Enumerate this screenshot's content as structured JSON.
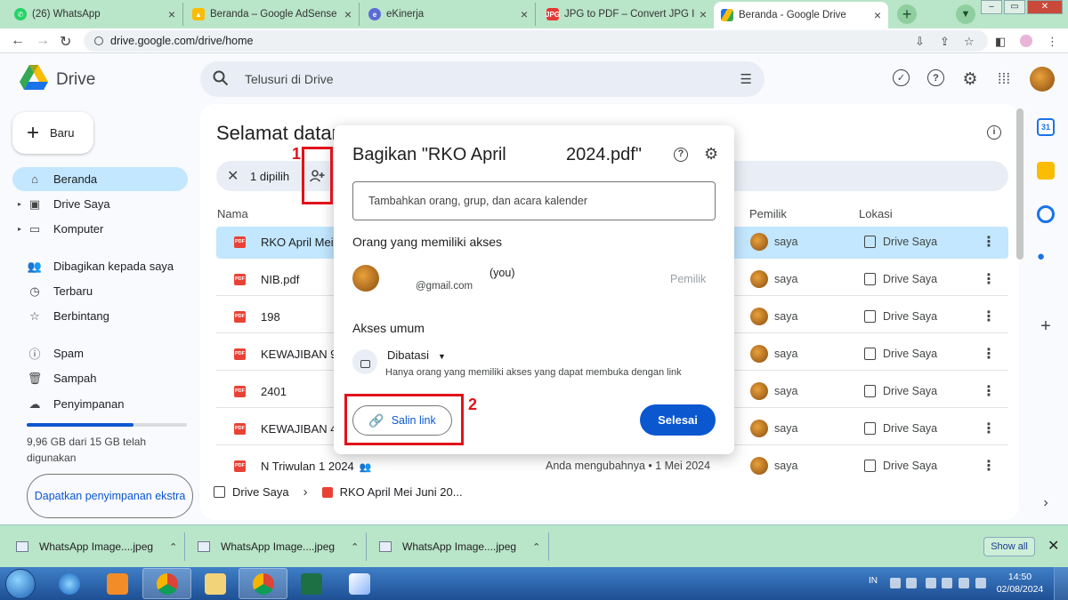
{
  "browser": {
    "tabs": [
      {
        "title": "(26) WhatsApp",
        "icon": "whatsapp-icon",
        "color": "#25d366"
      },
      {
        "title": "Beranda – Google AdSense",
        "icon": "adsense-icon",
        "color": "#fbbc04"
      },
      {
        "title": "eKinerja",
        "icon": "ekinerja-icon",
        "color": "#5b6bd6"
      },
      {
        "title": "JPG to PDF – Convert JPG Images",
        "icon": "jpg-to-pdf-icon",
        "color": "#e53935"
      },
      {
        "title": "Beranda - Google Drive",
        "icon": "google-drive-icon",
        "color": "#1a73e8"
      }
    ],
    "url": "drive.google.com/drive/home"
  },
  "drive": {
    "product_name": "Drive",
    "search_placeholder": "Telusuri di Drive",
    "new_button": "Baru",
    "nav": [
      {
        "label": "Beranda",
        "icon": "home-icon",
        "active": true
      },
      {
        "label": "Drive Saya",
        "icon": "my-drive-icon",
        "expandable": true
      },
      {
        "label": "Komputer",
        "icon": "computer-icon",
        "expandable": true
      },
      {
        "label": "Dibagikan kepada saya",
        "icon": "shared-icon"
      },
      {
        "label": "Terbaru",
        "icon": "clock-icon"
      },
      {
        "label": "Berbintang",
        "icon": "star-icon"
      },
      {
        "label": "Spam",
        "icon": "spam-icon"
      },
      {
        "label": "Sampah",
        "icon": "trash-icon"
      },
      {
        "label": "Penyimpanan",
        "icon": "cloud-icon"
      }
    ],
    "storage": {
      "text": "9,96 GB dari 15 GB telah digunakan",
      "used_fraction": 0.664
    },
    "get_storage": "Dapatkan penyimpanan ekstra",
    "greeting": "Selamat datang di Drive",
    "selection": {
      "count_label": "1 dipilih"
    },
    "columns": {
      "name": "Nama",
      "owner": "Pemilik",
      "location": "Lokasi"
    },
    "files": [
      {
        "name": "RKO April Mei Juni 2024.pdf",
        "modified": "",
        "owner": "saya",
        "location": "Drive Saya",
        "selected": true
      },
      {
        "name": "NIB.pdf",
        "modified": "",
        "owner": "saya",
        "location": "Drive Saya"
      },
      {
        "name": "198",
        "modified": "",
        "owner": "saya",
        "location": "Drive Saya"
      },
      {
        "name": "KEWAJIBAN 9",
        "modified": "",
        "owner": "saya",
        "location": "Drive Saya"
      },
      {
        "name": "2401",
        "modified": "",
        "owner": "saya",
        "location": "Drive Saya"
      },
      {
        "name": "KEWAJIBAN 4",
        "modified": "",
        "owner": "saya",
        "location": "Drive Saya"
      },
      {
        "name": "N Triwulan 1 2024",
        "modified": "Anda mengubahnya • 1 Mei 2024",
        "owner": "saya",
        "location": "Drive Saya",
        "shared": true
      }
    ],
    "breadcrumb": {
      "root": "Drive Saya",
      "file": "RKO April Mei Juni 20..."
    }
  },
  "share_dialog": {
    "title_part1": "Bagikan \"RKO April",
    "title_part2": "2024.pdf\"",
    "input_placeholder": "Tambahkan orang, grup, dan acara kalender",
    "people_heading": "Orang yang memiliki akses",
    "person_you": "(you)",
    "person_email": "@gmail.com",
    "person_role": "Pemilik",
    "general_heading": "Akses umum",
    "access_level": "Dibatasi",
    "access_desc": "Hanya orang yang memiliki akses yang dapat membuka dengan link",
    "copy_link": "Salin link",
    "done": "Selesai"
  },
  "annotations": [
    {
      "number": "1",
      "color": "#e1121b"
    },
    {
      "number": "2",
      "color": "#e1121b"
    }
  ],
  "downloads": {
    "items": [
      "WhatsApp Image....jpeg",
      "WhatsApp Image....jpeg",
      "WhatsApp Image....jpeg"
    ],
    "show_all": "Show all"
  },
  "taskbar": {
    "lang": "IN",
    "time": "14:50",
    "date": "02/08/2024"
  }
}
